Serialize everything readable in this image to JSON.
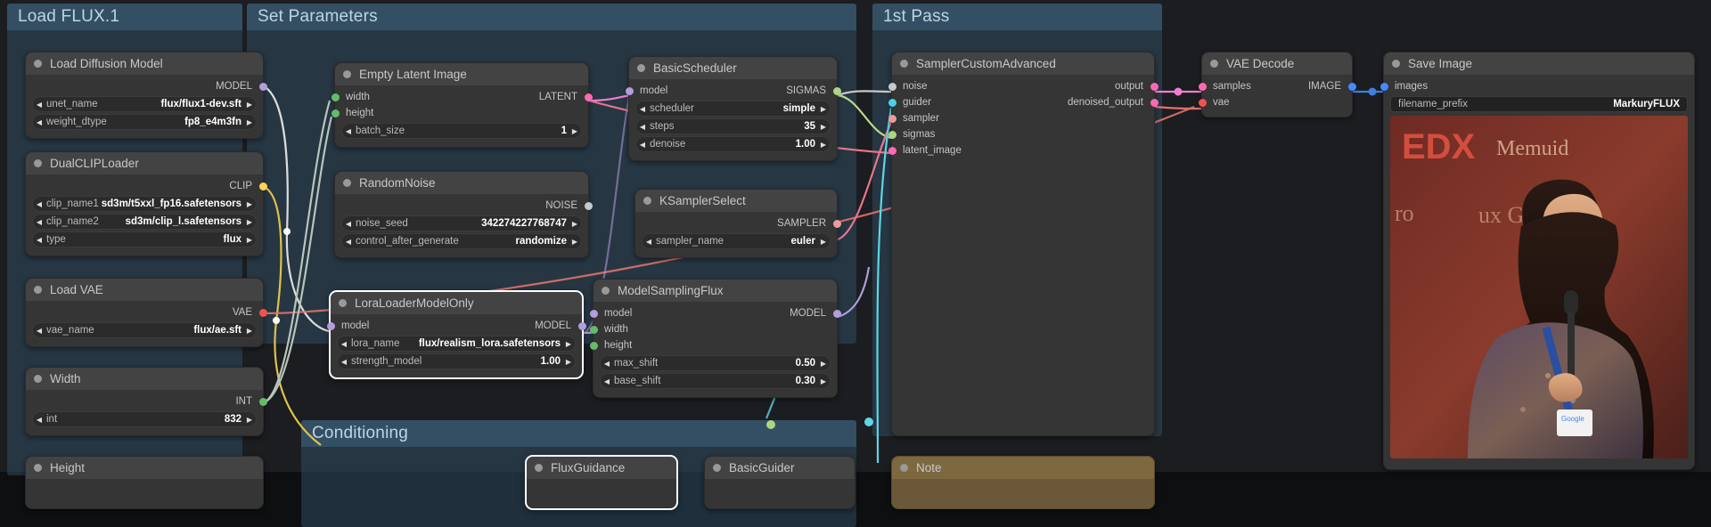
{
  "app": {
    "name": "ComfyUI Workflow Canvas"
  },
  "groups": [
    {
      "id": "load-flux",
      "title": "Load FLUX.1"
    },
    {
      "id": "set-parameters",
      "title": "Set Parameters"
    },
    {
      "id": "first-pass",
      "title": "1st Pass"
    },
    {
      "id": "conditioning",
      "title": "Conditioning"
    }
  ],
  "nodes": {
    "load_diffusion_model": {
      "title": "Load Diffusion Model",
      "outputs": [
        {
          "label": "MODEL",
          "color": "#b39ddb"
        }
      ],
      "widgets": [
        {
          "name": "unet_name",
          "value": "flux/flux1-dev.sft"
        },
        {
          "name": "weight_dtype",
          "value": "fp8_e4m3fn"
        }
      ]
    },
    "dual_clip_loader": {
      "title": "DualCLIPLoader",
      "outputs": [
        {
          "label": "CLIP",
          "color": "#ffd54f"
        }
      ],
      "widgets": [
        {
          "name": "clip_name1",
          "value": "sd3m/t5xxl_fp16.safetensors"
        },
        {
          "name": "clip_name2",
          "value": "sd3m/clip_l.safetensors"
        },
        {
          "name": "type",
          "value": "flux"
        }
      ]
    },
    "load_vae": {
      "title": "Load VAE",
      "outputs": [
        {
          "label": "VAE",
          "color": "#ef5350"
        }
      ],
      "widgets": [
        {
          "name": "vae_name",
          "value": "flux/ae.sft"
        }
      ]
    },
    "width_node": {
      "title": "Width",
      "outputs": [
        {
          "label": "INT",
          "color": "#66bb6a"
        }
      ],
      "widgets": [
        {
          "name": "int",
          "value": "832"
        }
      ]
    },
    "height_node": {
      "title": "Height",
      "outputs": [],
      "widgets": []
    },
    "empty_latent_image": {
      "title": "Empty Latent Image",
      "inputs": [
        {
          "label": "width",
          "color": "#66bb6a"
        },
        {
          "label": "height",
          "color": "#66bb6a"
        }
      ],
      "outputs": [
        {
          "label": "LATENT",
          "color": "#ff69b4"
        }
      ],
      "widgets": [
        {
          "name": "batch_size",
          "value": "1"
        }
      ]
    },
    "random_noise": {
      "title": "RandomNoise",
      "outputs": [
        {
          "label": "NOISE",
          "color": "#c8c8c8"
        }
      ],
      "widgets": [
        {
          "name": "noise_seed",
          "value": "342274227768747"
        },
        {
          "name": "control_after_generate",
          "value": "randomize"
        }
      ]
    },
    "lora_loader_model_only": {
      "title": "LoraLoaderModelOnly",
      "selected": true,
      "inputs": [
        {
          "label": "model",
          "color": "#b39ddb"
        }
      ],
      "outputs": [
        {
          "label": "MODEL",
          "color": "#b39ddb"
        }
      ],
      "widgets": [
        {
          "name": "lora_name",
          "value": "flux/realism_lora.safetensors"
        },
        {
          "name": "strength_model",
          "value": "1.00"
        }
      ]
    },
    "basic_scheduler": {
      "title": "BasicScheduler",
      "inputs": [
        {
          "label": "model",
          "color": "#b39ddb"
        }
      ],
      "outputs": [
        {
          "label": "SIGMAS",
          "color": "#aed581"
        }
      ],
      "widgets": [
        {
          "name": "scheduler",
          "value": "simple"
        },
        {
          "name": "steps",
          "value": "35"
        },
        {
          "name": "denoise",
          "value": "1.00"
        }
      ]
    },
    "ksampler_select": {
      "title": "KSamplerSelect",
      "outputs": [
        {
          "label": "SAMPLER",
          "color": "#ef9a9a"
        }
      ],
      "widgets": [
        {
          "name": "sampler_name",
          "value": "euler"
        }
      ]
    },
    "model_sampling_flux": {
      "title": "ModelSamplingFlux",
      "inputs": [
        {
          "label": "model",
          "color": "#b39ddb"
        },
        {
          "label": "width",
          "color": "#66bb6a"
        },
        {
          "label": "height",
          "color": "#66bb6a"
        }
      ],
      "outputs": [
        {
          "label": "MODEL",
          "color": "#b39ddb"
        }
      ],
      "widgets": [
        {
          "name": "max_shift",
          "value": "0.50"
        },
        {
          "name": "base_shift",
          "value": "0.30"
        }
      ]
    },
    "sampler_custom_advanced": {
      "title": "SamplerCustomAdvanced",
      "inputs": [
        {
          "label": "noise",
          "color": "#c8c8c8"
        },
        {
          "label": "guider",
          "color": "#4dd0e1"
        },
        {
          "label": "sampler",
          "color": "#ef9a9a"
        },
        {
          "label": "sigmas",
          "color": "#aed581"
        },
        {
          "label": "latent_image",
          "color": "#ff69b4"
        }
      ],
      "outputs": [
        {
          "label": "output",
          "color": "#ff69b4"
        },
        {
          "label": "denoised_output",
          "color": "#ff69b4"
        }
      ],
      "widgets": []
    },
    "vae_decode": {
      "title": "VAE Decode",
      "inputs": [
        {
          "label": "samples",
          "color": "#ff69b4"
        },
        {
          "label": "vae",
          "color": "#ef5350"
        }
      ],
      "outputs": [
        {
          "label": "IMAGE",
          "color": "#448aff"
        }
      ],
      "widgets": []
    },
    "save_image": {
      "title": "Save Image",
      "inputs": [
        {
          "label": "images",
          "color": "#448aff"
        }
      ],
      "outputs": [],
      "widgets": [
        {
          "name": "filename_prefix",
          "value": "MarkuryFLUX"
        }
      ]
    },
    "flux_guidance": {
      "title": "FluxGuidance",
      "selected": true
    },
    "basic_guider": {
      "title": "BasicGuider"
    },
    "note_node": {
      "title": "Note"
    }
  },
  "colors": {
    "node_bg": "#353535",
    "node_header": "#434343",
    "group_blue": "#314f65",
    "group_orange": "#65482c",
    "canvas": "#1b1d20",
    "accent_latent": "#ff69b4",
    "accent_model": "#b39ddb",
    "accent_clip": "#ffd54f",
    "accent_vae": "#ef5350",
    "accent_int": "#66bb6a",
    "accent_image": "#448aff"
  }
}
